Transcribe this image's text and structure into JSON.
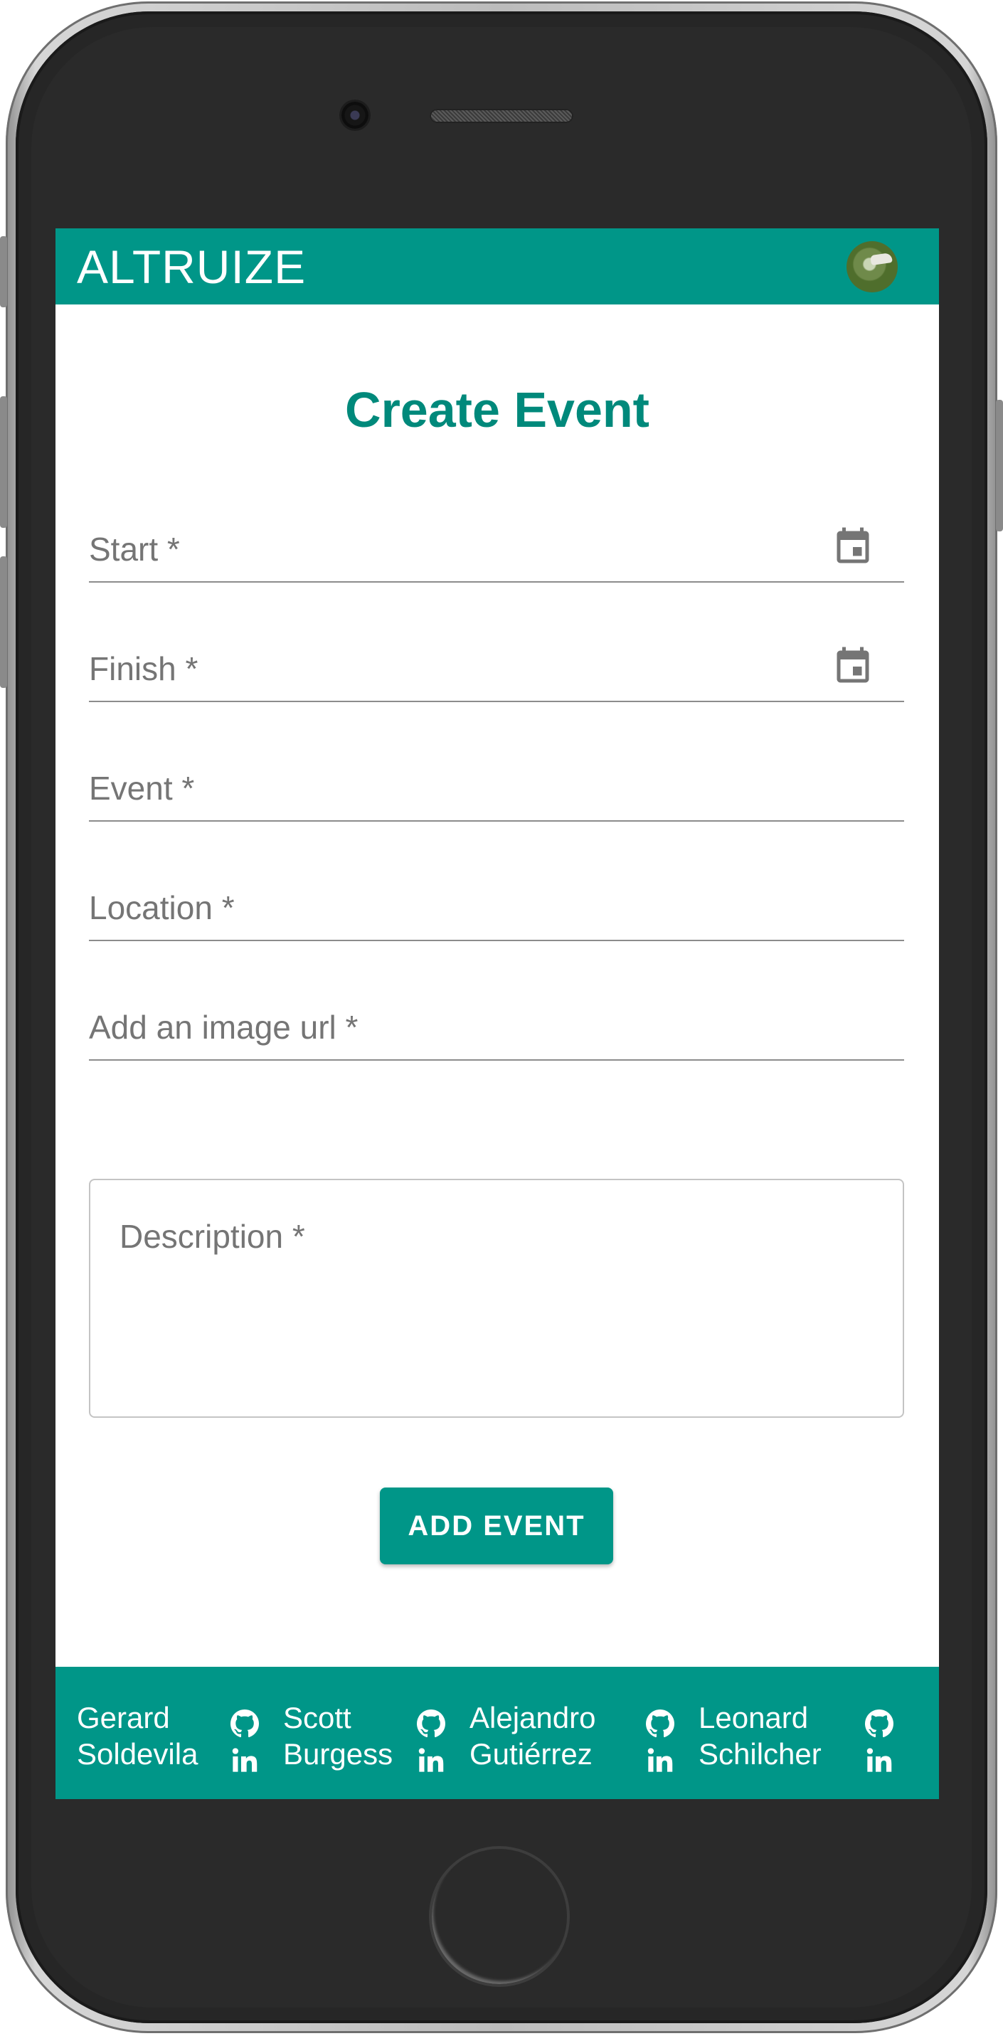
{
  "app": {
    "title": "ALTRUIZE"
  },
  "header": {
    "avatar_icon": "user-avatar"
  },
  "form": {
    "title": "Create Event",
    "start_label": "Start *",
    "finish_label": "Finish *",
    "event_label": "Event *",
    "location_label": "Location *",
    "image_url_label": "Add an image url *",
    "description_label": "Description *",
    "calendar_icon": "calendar-icon",
    "submit_label": "ADD EVENT"
  },
  "footer": {
    "members": [
      {
        "first": "Gerard",
        "last": "Soldevila"
      },
      {
        "first": "Scott",
        "last": "Burgess"
      },
      {
        "first": "Alejandro",
        "last": "Gutiérrez"
      },
      {
        "first": "Leonard",
        "last": "Schilcher"
      }
    ],
    "icons": [
      "github-icon",
      "linkedin-icon"
    ]
  },
  "colors": {
    "primary": "#009688",
    "title": "#00897b",
    "label": "#757575"
  }
}
